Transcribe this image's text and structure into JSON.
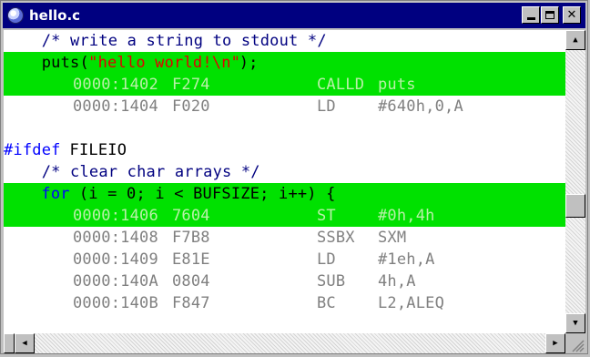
{
  "window": {
    "title": "hello.c"
  },
  "colors": {
    "titlebar": "#000080",
    "source_text": "#000000",
    "comment_text": "#000080",
    "keyword_text": "#0000ff",
    "string_text": "#e00000",
    "address_text": "#808080",
    "highlight_bg": "#00e100",
    "highlight_asm_text": "#b9f0a8"
  },
  "lines": [
    {
      "type": "comment",
      "highlight": false,
      "text": "    /* write a string to stdout */"
    },
    {
      "type": "source",
      "highlight": true,
      "segments": [
        {
          "text": "    puts(",
          "role": "plain"
        },
        {
          "text": "\"hello world!\\n\"",
          "role": "string"
        },
        {
          "text": ");",
          "role": "plain"
        }
      ]
    },
    {
      "type": "asm",
      "highlight": true,
      "address": "0000:1402",
      "opcode": "F274",
      "mnemonic": "CALLD",
      "operand": "puts"
    },
    {
      "type": "asm",
      "highlight": false,
      "address": "0000:1404",
      "opcode": "F020",
      "mnemonic": "LD",
      "operand": "#640h,0,A"
    },
    {
      "type": "blank",
      "highlight": false,
      "text": ""
    },
    {
      "type": "source",
      "highlight": false,
      "segments": [
        {
          "text": "#ifdef",
          "role": "keyword"
        },
        {
          "text": " FILEIO",
          "role": "plain"
        }
      ]
    },
    {
      "type": "comment",
      "highlight": false,
      "text": "    /* clear char arrays */"
    },
    {
      "type": "source",
      "highlight": true,
      "segments": [
        {
          "text": "    ",
          "role": "plain"
        },
        {
          "text": "for",
          "role": "keyword"
        },
        {
          "text": " (i = 0; i < BUFSIZE; i++) {",
          "role": "plain"
        }
      ]
    },
    {
      "type": "asm",
      "highlight": true,
      "address": "0000:1406",
      "opcode": "7604",
      "mnemonic": "ST",
      "operand": "#0h,4h"
    },
    {
      "type": "asm",
      "highlight": false,
      "address": "0000:1408",
      "opcode": "F7B8",
      "mnemonic": "SSBX",
      "operand": "SXM"
    },
    {
      "type": "asm",
      "highlight": false,
      "address": "0000:1409",
      "opcode": "E81E",
      "mnemonic": "LD",
      "operand": "#1eh,A"
    },
    {
      "type": "asm",
      "highlight": false,
      "address": "0000:140A",
      "opcode": "0804",
      "mnemonic": "SUB",
      "operand": "4h,A"
    },
    {
      "type": "asm",
      "highlight": false,
      "address": "0000:140B",
      "opcode": "F847",
      "mnemonic": "BC",
      "operand": "L2,ALEQ"
    }
  ],
  "scrollbars": {
    "vertical": {
      "thumb_position": 0.6
    },
    "horizontal": {
      "thumb_position": 0.0
    }
  }
}
